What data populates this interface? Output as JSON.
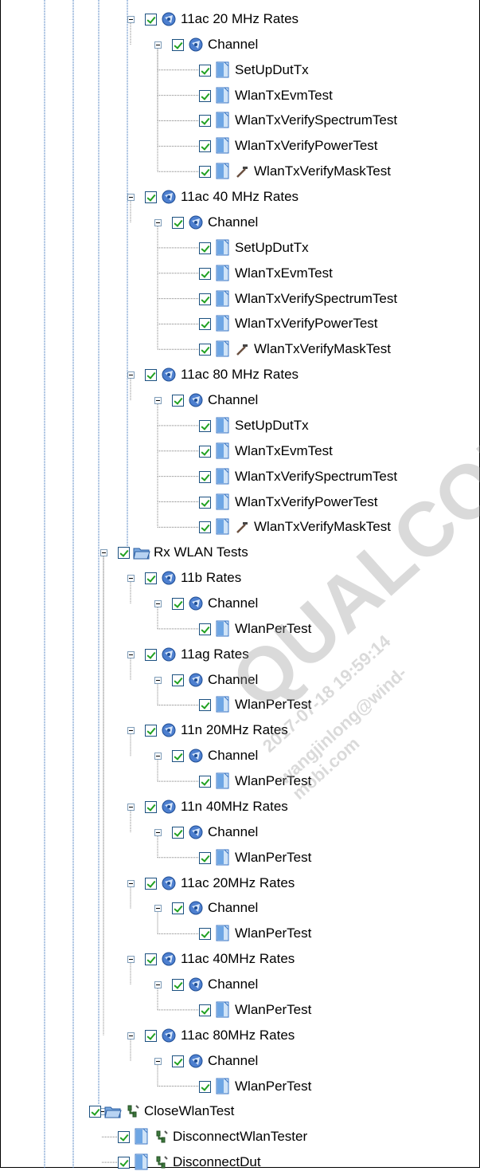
{
  "tree": {
    "rows": [
      {
        "label": "11ac 20 MHz Rates",
        "level": 2,
        "kind": "group",
        "expander": true
      },
      {
        "label": "Channel",
        "level": 3,
        "kind": "group",
        "expander": true
      },
      {
        "label": "SetUpDutTx",
        "level": 4,
        "kind": "test"
      },
      {
        "label": "WlanTxEvmTest",
        "level": 4,
        "kind": "test"
      },
      {
        "label": "WlanTxVerifySpectrumTest",
        "level": 4,
        "kind": "test"
      },
      {
        "label": "WlanTxVerifyPowerTest",
        "level": 4,
        "kind": "test"
      },
      {
        "label": "WlanTxVerifyMaskTest",
        "level": 4,
        "kind": "test",
        "extra": "hammer"
      },
      {
        "label": "11ac 40 MHz Rates",
        "level": 2,
        "kind": "group",
        "expander": true
      },
      {
        "label": "Channel",
        "level": 3,
        "kind": "group",
        "expander": true
      },
      {
        "label": "SetUpDutTx",
        "level": 4,
        "kind": "test"
      },
      {
        "label": "WlanTxEvmTest",
        "level": 4,
        "kind": "test"
      },
      {
        "label": "WlanTxVerifySpectrumTest",
        "level": 4,
        "kind": "test"
      },
      {
        "label": "WlanTxVerifyPowerTest",
        "level": 4,
        "kind": "test"
      },
      {
        "label": "WlanTxVerifyMaskTest",
        "level": 4,
        "kind": "test",
        "extra": "hammer"
      },
      {
        "label": "11ac 80 MHz Rates",
        "level": 2,
        "kind": "group",
        "expander": true
      },
      {
        "label": "Channel",
        "level": 3,
        "kind": "group",
        "expander": true
      },
      {
        "label": "SetUpDutTx",
        "level": 4,
        "kind": "test"
      },
      {
        "label": "WlanTxEvmTest",
        "level": 4,
        "kind": "test"
      },
      {
        "label": "WlanTxVerifySpectrumTest",
        "level": 4,
        "kind": "test"
      },
      {
        "label": "WlanTxVerifyPowerTest",
        "level": 4,
        "kind": "test"
      },
      {
        "label": "WlanTxVerifyMaskTest",
        "level": 4,
        "kind": "test",
        "extra": "hammer"
      },
      {
        "label": "Rx WLAN Tests",
        "level": 1,
        "kind": "folder",
        "expander": true
      },
      {
        "label": "11b Rates",
        "level": 2,
        "kind": "group",
        "expander": true
      },
      {
        "label": "Channel",
        "level": 3,
        "kind": "group",
        "expander": true
      },
      {
        "label": "WlanPerTest",
        "level": 4,
        "kind": "test"
      },
      {
        "label": "11ag Rates",
        "level": 2,
        "kind": "group",
        "expander": true
      },
      {
        "label": "Channel",
        "level": 3,
        "kind": "group",
        "expander": true
      },
      {
        "label": "WlanPerTest",
        "level": 4,
        "kind": "test"
      },
      {
        "label": "11n 20MHz Rates",
        "level": 2,
        "kind": "group",
        "expander": true
      },
      {
        "label": "Channel",
        "level": 3,
        "kind": "group",
        "expander": true
      },
      {
        "label": "WlanPerTest",
        "level": 4,
        "kind": "test"
      },
      {
        "label": "11n 40MHz Rates",
        "level": 2,
        "kind": "group",
        "expander": true
      },
      {
        "label": "Channel",
        "level": 3,
        "kind": "group",
        "expander": true
      },
      {
        "label": "WlanPerTest",
        "level": 4,
        "kind": "test"
      },
      {
        "label": "11ac 20MHz Rates",
        "level": 2,
        "kind": "group",
        "expander": true
      },
      {
        "label": "Channel",
        "level": 3,
        "kind": "group",
        "expander": true
      },
      {
        "label": "WlanPerTest",
        "level": 4,
        "kind": "test"
      },
      {
        "label": "11ac 40MHz Rates",
        "level": 2,
        "kind": "group",
        "expander": true
      },
      {
        "label": "Channel",
        "level": 3,
        "kind": "group",
        "expander": true
      },
      {
        "label": "WlanPerTest",
        "level": 4,
        "kind": "test"
      },
      {
        "label": "11ac 80MHz Rates",
        "level": 2,
        "kind": "group",
        "expander": true
      },
      {
        "label": "Channel",
        "level": 3,
        "kind": "group",
        "expander": true
      },
      {
        "label": "WlanPerTest",
        "level": 4,
        "kind": "test"
      },
      {
        "label": "CloseWlanTest",
        "level": 0,
        "kind": "folder",
        "expander": true,
        "extra": "tool"
      },
      {
        "label": "DisconnectWlanTester",
        "level": 1,
        "kind": "test",
        "extra": "tool"
      },
      {
        "label": "DisconnectDut",
        "level": 1,
        "kind": "test",
        "extra": "tool"
      }
    ]
  },
  "watermark": {
    "brand": "QUALCOMM",
    "stamp": "2017-07-18 19:59:14",
    "email": "wangjinlong@wind-mobi.com"
  },
  "colors": {
    "check": "#21a121",
    "checkbox_border": "#1c5180",
    "tree_line": "#7f7f7f",
    "guide_line": "#1f5fb0",
    "page_icon": "#4d8fd6"
  }
}
